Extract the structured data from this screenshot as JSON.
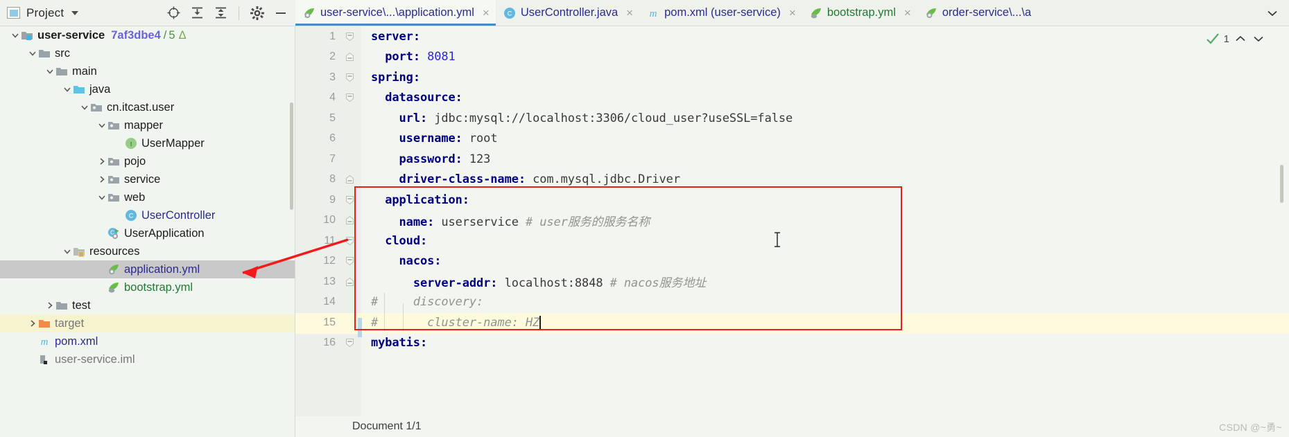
{
  "project_toolbar": {
    "title": "Project",
    "logo_icon": "project-panel-icon",
    "dropdown_icon": "chevron-down-icon",
    "buttons": [
      {
        "name": "locate-icon",
        "label": ""
      },
      {
        "name": "expand-all-icon",
        "label": ""
      },
      {
        "name": "collapse-all-icon",
        "label": ""
      },
      {
        "name": "settings-gear-icon",
        "label": ""
      },
      {
        "name": "hide-panel-icon",
        "label": ""
      }
    ]
  },
  "tree": {
    "items": [
      {
        "label": "user-service",
        "indent": 0,
        "arrow": "down",
        "icon": "module-folder-icon",
        "bold": true,
        "badge_hash": "7af3dbe4",
        "badge_slash": "/",
        "badge_count": "5",
        "badge_tri": "Δ",
        "state": "normal"
      },
      {
        "label": "src",
        "indent": 1,
        "arrow": "down",
        "icon": "folder-icon",
        "state": "normal"
      },
      {
        "label": "main",
        "indent": 2,
        "arrow": "down",
        "icon": "folder-icon",
        "state": "normal"
      },
      {
        "label": "java",
        "indent": 3,
        "arrow": "down",
        "icon": "source-folder-icon",
        "state": "normal"
      },
      {
        "label": "cn.itcast.user",
        "indent": 4,
        "arrow": "down",
        "icon": "package-icon",
        "state": "normal"
      },
      {
        "label": "mapper",
        "indent": 5,
        "arrow": "down",
        "icon": "package-icon",
        "state": "normal"
      },
      {
        "label": "UserMapper",
        "indent": 6,
        "arrow": "none",
        "icon": "interface-icon",
        "state": "normal"
      },
      {
        "label": "pojo",
        "indent": 5,
        "arrow": "right",
        "icon": "package-icon",
        "state": "normal"
      },
      {
        "label": "service",
        "indent": 5,
        "arrow": "right",
        "icon": "package-icon",
        "state": "normal"
      },
      {
        "label": "web",
        "indent": 5,
        "arrow": "down",
        "icon": "package-icon",
        "state": "normal"
      },
      {
        "label": "UserController",
        "indent": 6,
        "arrow": "none",
        "icon": "class-icon",
        "color": "blue",
        "state": "normal"
      },
      {
        "label": "UserApplication",
        "indent": 5,
        "arrow": "none",
        "icon": "class-runnable-icon",
        "state": "normal"
      },
      {
        "label": "resources",
        "indent": 3,
        "arrow": "down",
        "icon": "resources-folder-icon",
        "state": "normal"
      },
      {
        "label": "application.yml",
        "indent": 5,
        "arrow": "none",
        "icon": "yaml-spring-icon",
        "color": "blue",
        "state": "selected"
      },
      {
        "label": "bootstrap.yml",
        "indent": 5,
        "arrow": "none",
        "icon": "yaml-icon",
        "color": "green",
        "state": "normal"
      },
      {
        "label": "test",
        "indent": 2,
        "arrow": "right",
        "icon": "folder-icon",
        "state": "normal"
      },
      {
        "label": "target",
        "indent": 1,
        "arrow": "right",
        "icon": "folder-excluded-icon",
        "color": "gray",
        "state": "highlight"
      },
      {
        "label": "pom.xml",
        "indent": 1,
        "arrow": "none",
        "icon": "maven-icon",
        "color": "blue",
        "state": "normal"
      },
      {
        "label": "user-service.iml",
        "indent": 1,
        "arrow": "none",
        "icon": "iml-icon",
        "color": "gray",
        "state": "normal"
      }
    ]
  },
  "tabs": {
    "items": [
      {
        "label": "user-service\\...\\application.yml",
        "icon": "yaml-spring-icon",
        "color": "blue",
        "active": true,
        "close": "×"
      },
      {
        "label": "UserController.java",
        "icon": "class-icon",
        "color": "blue",
        "active": false,
        "close": "×"
      },
      {
        "label": "pom.xml (user-service)",
        "icon": "maven-icon",
        "color": "blue",
        "active": false,
        "close": "×"
      },
      {
        "label": "bootstrap.yml",
        "icon": "yaml-icon",
        "color": "green",
        "active": false,
        "close": "×"
      },
      {
        "label": "order-service\\...\\a",
        "icon": "yaml-spring-icon",
        "color": "blue",
        "active": false,
        "close": ""
      }
    ],
    "overflow_icon": "chevron-down-icon"
  },
  "editor": {
    "lines": [
      {
        "no": "1",
        "indent": 0,
        "key": "server",
        "colon": ":",
        "value": "",
        "comment": "",
        "fold": "collapse"
      },
      {
        "no": "2",
        "indent": 1,
        "key": "port",
        "colon": ":",
        "value": " 8081",
        "value_type": "num",
        "comment": "",
        "fold": "end"
      },
      {
        "no": "3",
        "indent": 0,
        "key": "spring",
        "colon": ":",
        "value": "",
        "comment": "",
        "fold": "collapse"
      },
      {
        "no": "4",
        "indent": 1,
        "key": "datasource",
        "colon": ":",
        "value": "",
        "comment": "",
        "fold": "collapse"
      },
      {
        "no": "5",
        "indent": 2,
        "key": "url",
        "colon": ":",
        "value": " jdbc:mysql://localhost:3306/cloud_user?useSSL=false",
        "comment": "",
        "fold": ""
      },
      {
        "no": "6",
        "indent": 2,
        "key": "username",
        "colon": ":",
        "value": " root",
        "comment": "",
        "fold": ""
      },
      {
        "no": "7",
        "indent": 2,
        "key": "password",
        "colon": ":",
        "value": " 123",
        "comment": "",
        "fold": ""
      },
      {
        "no": "8",
        "indent": 2,
        "key": "driver-class-name",
        "colon": ":",
        "value": " com.mysql.jdbc.Driver",
        "comment": "",
        "fold": "end"
      },
      {
        "no": "9",
        "indent": 1,
        "key": "application",
        "colon": ":",
        "value": "",
        "comment": "",
        "fold": "collapse"
      },
      {
        "no": "10",
        "indent": 2,
        "key": "name",
        "colon": ":",
        "value": " userservice ",
        "comment": "# user服务的服务名称",
        "fold": "end"
      },
      {
        "no": "11",
        "indent": 1,
        "key": "cloud",
        "colon": ":",
        "value": "",
        "comment": "",
        "fold": "collapse"
      },
      {
        "no": "12",
        "indent": 2,
        "key": "nacos",
        "colon": ":",
        "value": "",
        "comment": "",
        "fold": "collapse"
      },
      {
        "no": "13",
        "indent": 3,
        "key": "server-addr",
        "colon": ":",
        "value": " localhost:8848 ",
        "comment": "# nacos服务地址",
        "fold": "end"
      },
      {
        "no": "14",
        "indent": 0,
        "key": "",
        "colon": "",
        "value": "",
        "comment": "#     discovery:",
        "full_comment": true,
        "fold": ""
      },
      {
        "no": "15",
        "indent": 0,
        "key": "",
        "colon": "",
        "value": "",
        "comment": "#       cluster-name: HZ",
        "full_comment": true,
        "fold": "",
        "caret": true
      },
      {
        "no": "16",
        "indent": 0,
        "key": "mybatis",
        "colon": ":",
        "value": "",
        "comment": "",
        "fold": "collapse"
      }
    ],
    "inspection_count": "1",
    "inspection_icon": "inspection-ok-icon",
    "up_icon": "chevron-up-icon",
    "down_icon": "chevron-down-icon"
  },
  "statusbar": {
    "document_label": "Document 1/1",
    "watermark": "CSDN @~勇~"
  }
}
